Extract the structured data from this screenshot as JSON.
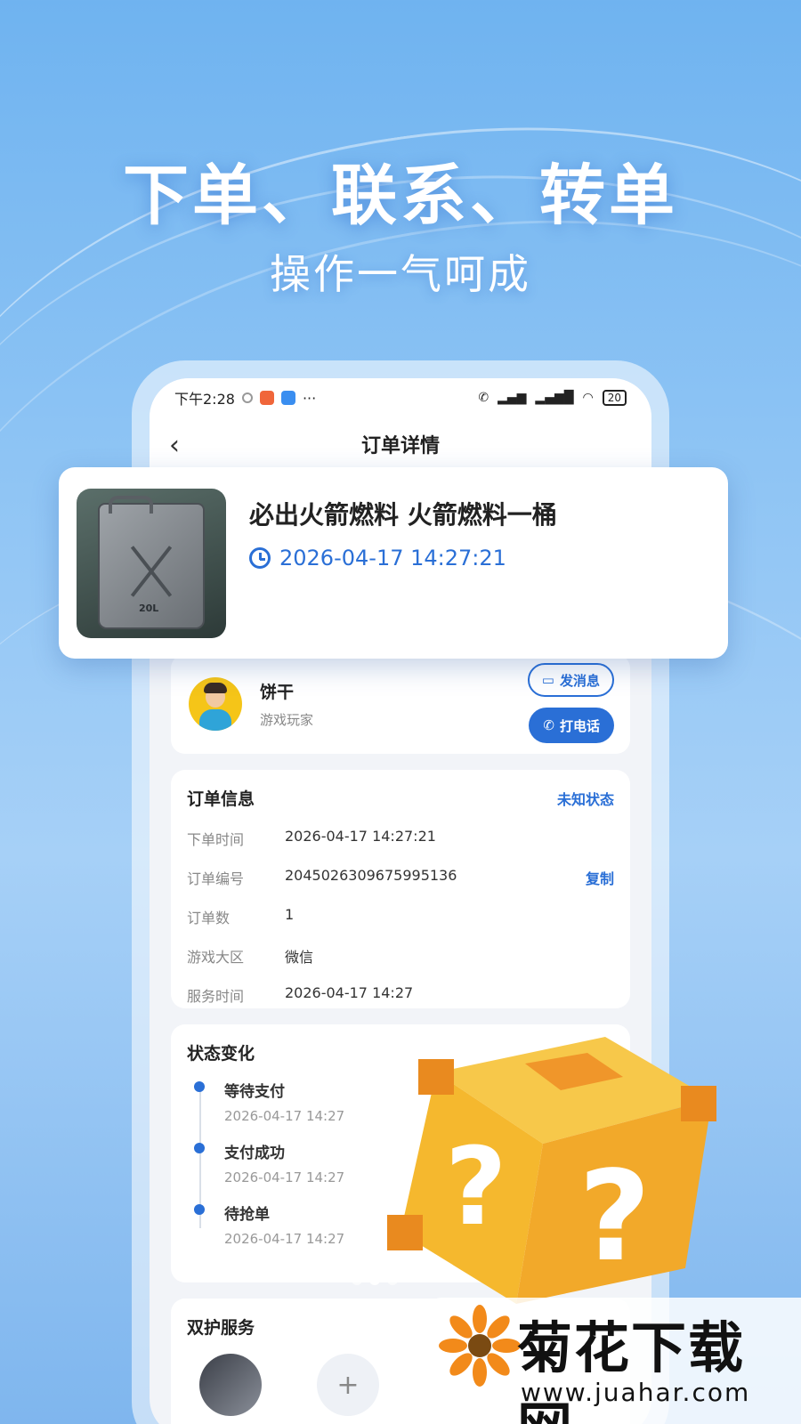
{
  "promo": {
    "headline": "下单、联系、转单",
    "subline": "操作一气呵成"
  },
  "status_bar": {
    "time": "下午2:28",
    "dots": "···",
    "battery": "20"
  },
  "nav": {
    "title": "订单详情",
    "back_icon": "‹"
  },
  "product": {
    "title": "必出火箭燃料 火箭燃料一桶",
    "time": "2026-04-17 14:27:21",
    "image_label": "20L"
  },
  "user": {
    "name": "饼干",
    "role": "游戏玩家",
    "msg_label": "发消息",
    "call_label": "打电话"
  },
  "order_info": {
    "title": "订单信息",
    "status": "未知状态",
    "rows": [
      {
        "label": "下单时间",
        "value": "2026-04-17 14:27:21"
      },
      {
        "label": "订单编号",
        "value": "2045026309675995136",
        "action": "复制"
      },
      {
        "label": "订单数",
        "value": "1"
      },
      {
        "label": "游戏大区",
        "value": "微信"
      },
      {
        "label": "服务时间",
        "value": "2026-04-17 14:27"
      }
    ]
  },
  "status_change": {
    "title": "状态变化",
    "items": [
      {
        "title": "等待支付",
        "time": "2026-04-17 14:27"
      },
      {
        "title": "支付成功",
        "time": "2026-04-17 14:27"
      },
      {
        "title": "待抢单",
        "time": "2026-04-17 14:27"
      }
    ]
  },
  "guard_service": {
    "title": "双护服务",
    "add_symbol": "+"
  },
  "watermark": {
    "title": "菊花下载网",
    "url": "www.juahar.com"
  },
  "colors": {
    "accent": "#2a6fd6",
    "box_yellow": "#f5b82e",
    "box_orange": "#e98a1f"
  }
}
